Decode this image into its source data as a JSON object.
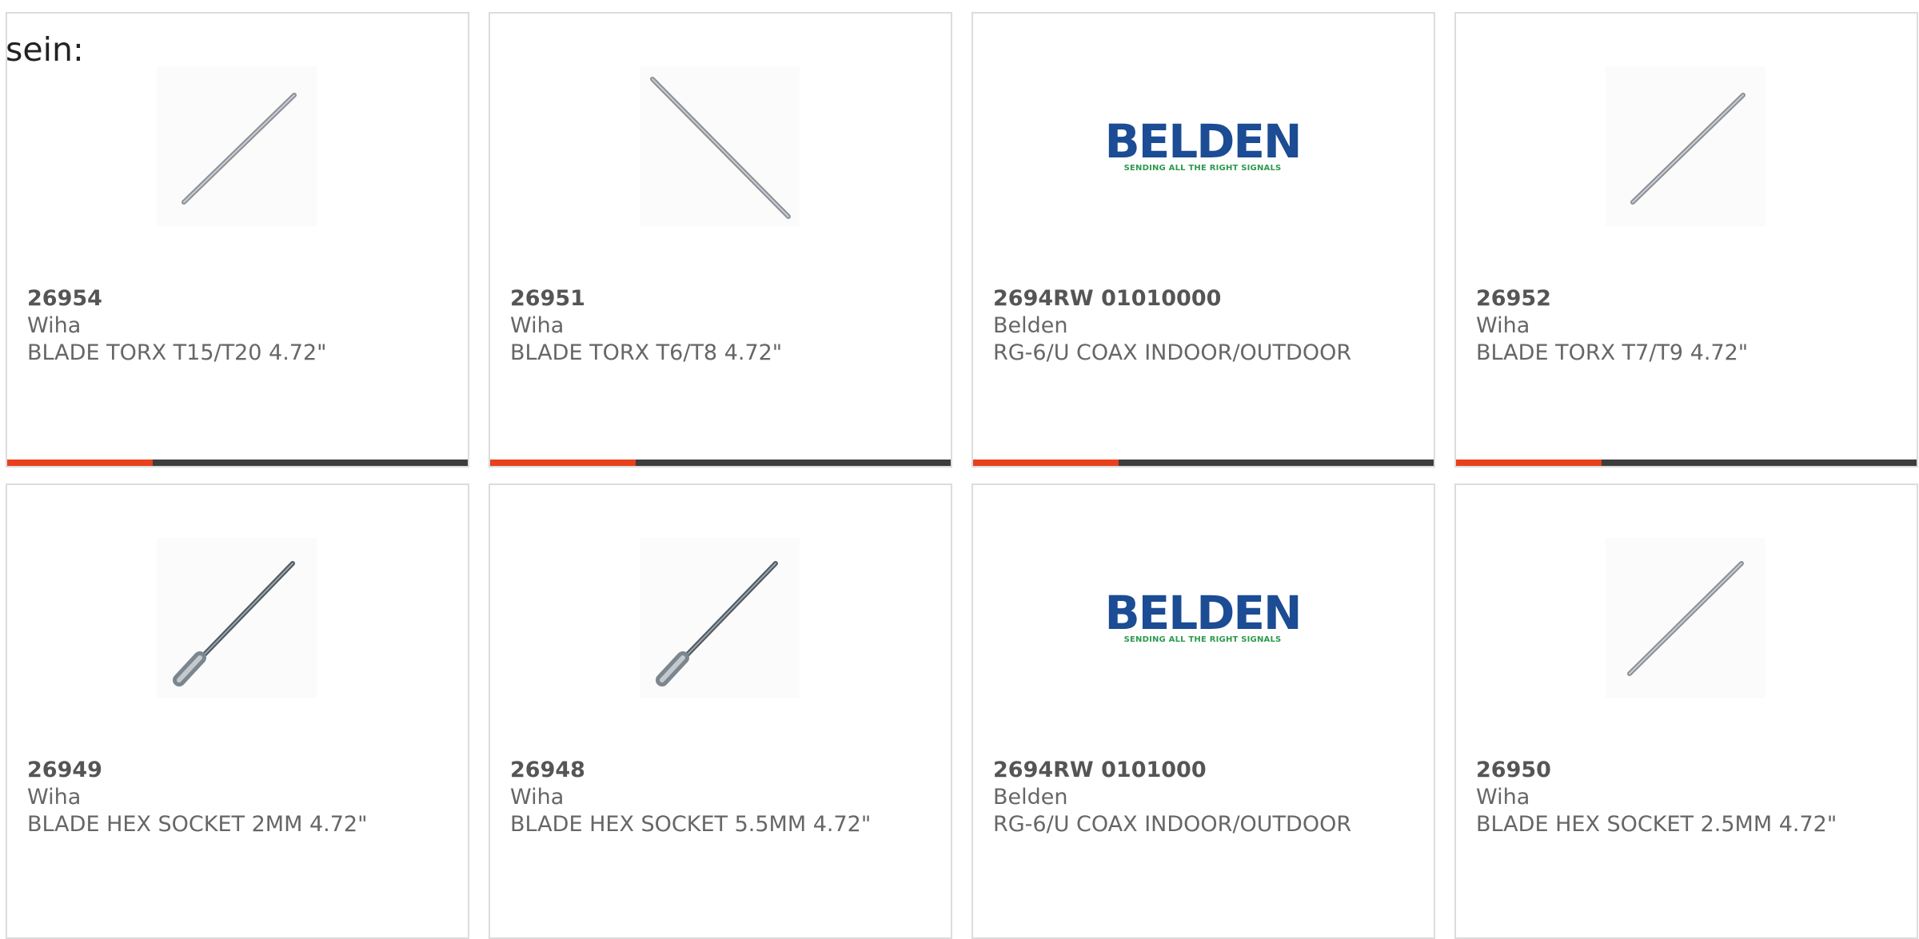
{
  "page": {
    "label": "sein:"
  },
  "colors": {
    "accent": "#e8401c",
    "bar": "#3d3d3d",
    "border": "#dcdcdc",
    "text": "#666666",
    "belden_blue": "#1b4c94",
    "belden_green": "#2c9a4e"
  },
  "products": [
    {
      "part": "26954",
      "maker": "Wiha",
      "desc": "BLADE TORX T15/T20 4.72\"",
      "image": "torx-blade-icon"
    },
    {
      "part": "26951",
      "maker": "Wiha",
      "desc": "BLADE TORX T6/T8 4.72\"",
      "image": "torx-blade-icon"
    },
    {
      "part": "2694RW 01010000",
      "maker": "Belden",
      "desc": "RG-6/U COAX INDOOR/OUTDOOR",
      "image": "belden-logo",
      "logo_word": "BELDEN",
      "logo_tag": "SENDING ALL THE RIGHT SIGNALS"
    },
    {
      "part": "26952",
      "maker": "Wiha",
      "desc": "BLADE TORX T7/T9 4.72\"",
      "image": "torx-blade-icon"
    },
    {
      "part": "26949",
      "maker": "Wiha",
      "desc": "BLADE HEX SOCKET 2MM 4.72\"",
      "image": "hex-socket-blade-icon"
    },
    {
      "part": "26948",
      "maker": "Wiha",
      "desc": "BLADE HEX SOCKET 5.5MM 4.72\"",
      "image": "hex-socket-blade-icon"
    },
    {
      "part": "2694RW 0101000",
      "maker": "Belden",
      "desc": "RG-6/U COAX INDOOR/OUTDOOR",
      "image": "belden-logo",
      "logo_word": "BELDEN",
      "logo_tag": "SENDING ALL THE RIGHT SIGNALS"
    },
    {
      "part": "26950",
      "maker": "Wiha",
      "desc": "BLADE HEX SOCKET 2.5MM 4.72\"",
      "image": "hex-blade-icon"
    }
  ]
}
